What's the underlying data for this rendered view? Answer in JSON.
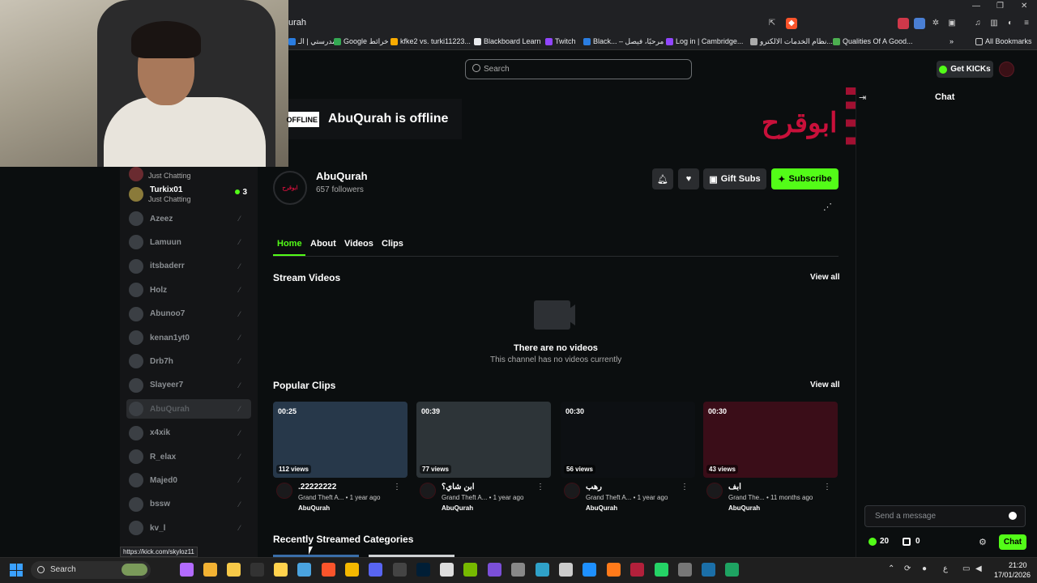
{
  "browser": {
    "url_fragment": "urah",
    "bookmarks": [
      {
        "label": "مدرستي | الـ",
        "color": "#2a7de1"
      },
      {
        "label": "Google خرائط",
        "color": "#34a853"
      },
      {
        "label": "kfke2 vs. turki11223...",
        "color": "#f9ab00"
      },
      {
        "label": "Blackboard Learn",
        "color": "#e8eaed"
      },
      {
        "label": "Twitch",
        "color": "#9146ff"
      },
      {
        "label": "Black... – مرحبًا، فيصل",
        "color": "#2a7de1"
      },
      {
        "label": "Log in | Cambridge...",
        "color": "#9146ff"
      },
      {
        "label": "نظام الخدمات الالكترو...",
        "color": "#aaaaaa"
      },
      {
        "label": "Qualities Of A Good...",
        "color": "#4caf50"
      }
    ],
    "all_bookmarks": "All Bookmarks",
    "overflow": "»"
  },
  "header": {
    "search_placeholder": "Search",
    "get_kicks": "Get KICKs"
  },
  "sidebar": {
    "live": [
      {
        "name": "Turkix01",
        "category": "Just Chatting",
        "viewers": "3"
      }
    ],
    "partial_category": "Just Chatting",
    "offline": [
      "Azeez",
      "Lamuun",
      "itsbaderr",
      "Holz",
      "Abunoo7",
      "kenan1yt0",
      "Drb7h",
      "Slayeer7",
      "AbuQurah",
      "x4xik",
      "R_elax",
      "Majed0",
      "bssw",
      "kv_l"
    ]
  },
  "channel": {
    "offline_badge": "OFFLINE",
    "offline_title": "AbuQurah is offline",
    "banner_logo": "ابوقرح",
    "avatar_text": "ابوقرح",
    "name": "AbuQurah",
    "followers": "657 followers",
    "gift_subs": "Gift Subs",
    "subscribe": "Subscribe"
  },
  "tabs": [
    "Home",
    "About",
    "Videos",
    "Clips"
  ],
  "stream_videos": {
    "title": "Stream Videos",
    "view_all": "View all",
    "empty_title": "There are no videos",
    "empty_sub": "This channel has no videos currently"
  },
  "popular_clips": {
    "title": "Popular Clips",
    "view_all": "View all",
    "clips": [
      {
        "duration": "00:25",
        "views": "112 views",
        "title": ".22222222",
        "game": "Grand Theft A...",
        "age": "• 1 year ago",
        "user": "AbuQurah",
        "bg": "#27384a"
      },
      {
        "duration": "00:39",
        "views": "77 views",
        "title": "ابن شاي؟",
        "game": "Grand Theft A...",
        "age": "• 1 year ago",
        "user": "AbuQurah",
        "bg": "#2d3438"
      },
      {
        "duration": "00:30",
        "views": "56 views",
        "title": "رهب",
        "game": "Grand Theft A...",
        "age": "• 1 year ago",
        "user": "AbuQurah",
        "bg": "#0d1013"
      },
      {
        "duration": "00:30",
        "views": "43 views",
        "title": "ابف",
        "game": "Grand The...",
        "age": "• 11 months ago",
        "user": "AbuQurah",
        "bg": "#3a0d18"
      }
    ]
  },
  "recent_categories": {
    "title": "Recently Streamed Categories"
  },
  "chat": {
    "title": "Chat",
    "placeholder": "Send a message",
    "kicks": "20",
    "store": "0",
    "send": "Chat"
  },
  "status_link": "https://kick.com/skyloz11",
  "taskbar": {
    "search": "Search",
    "time": "21:20",
    "date": "17/01/2026",
    "lang": "ع"
  }
}
